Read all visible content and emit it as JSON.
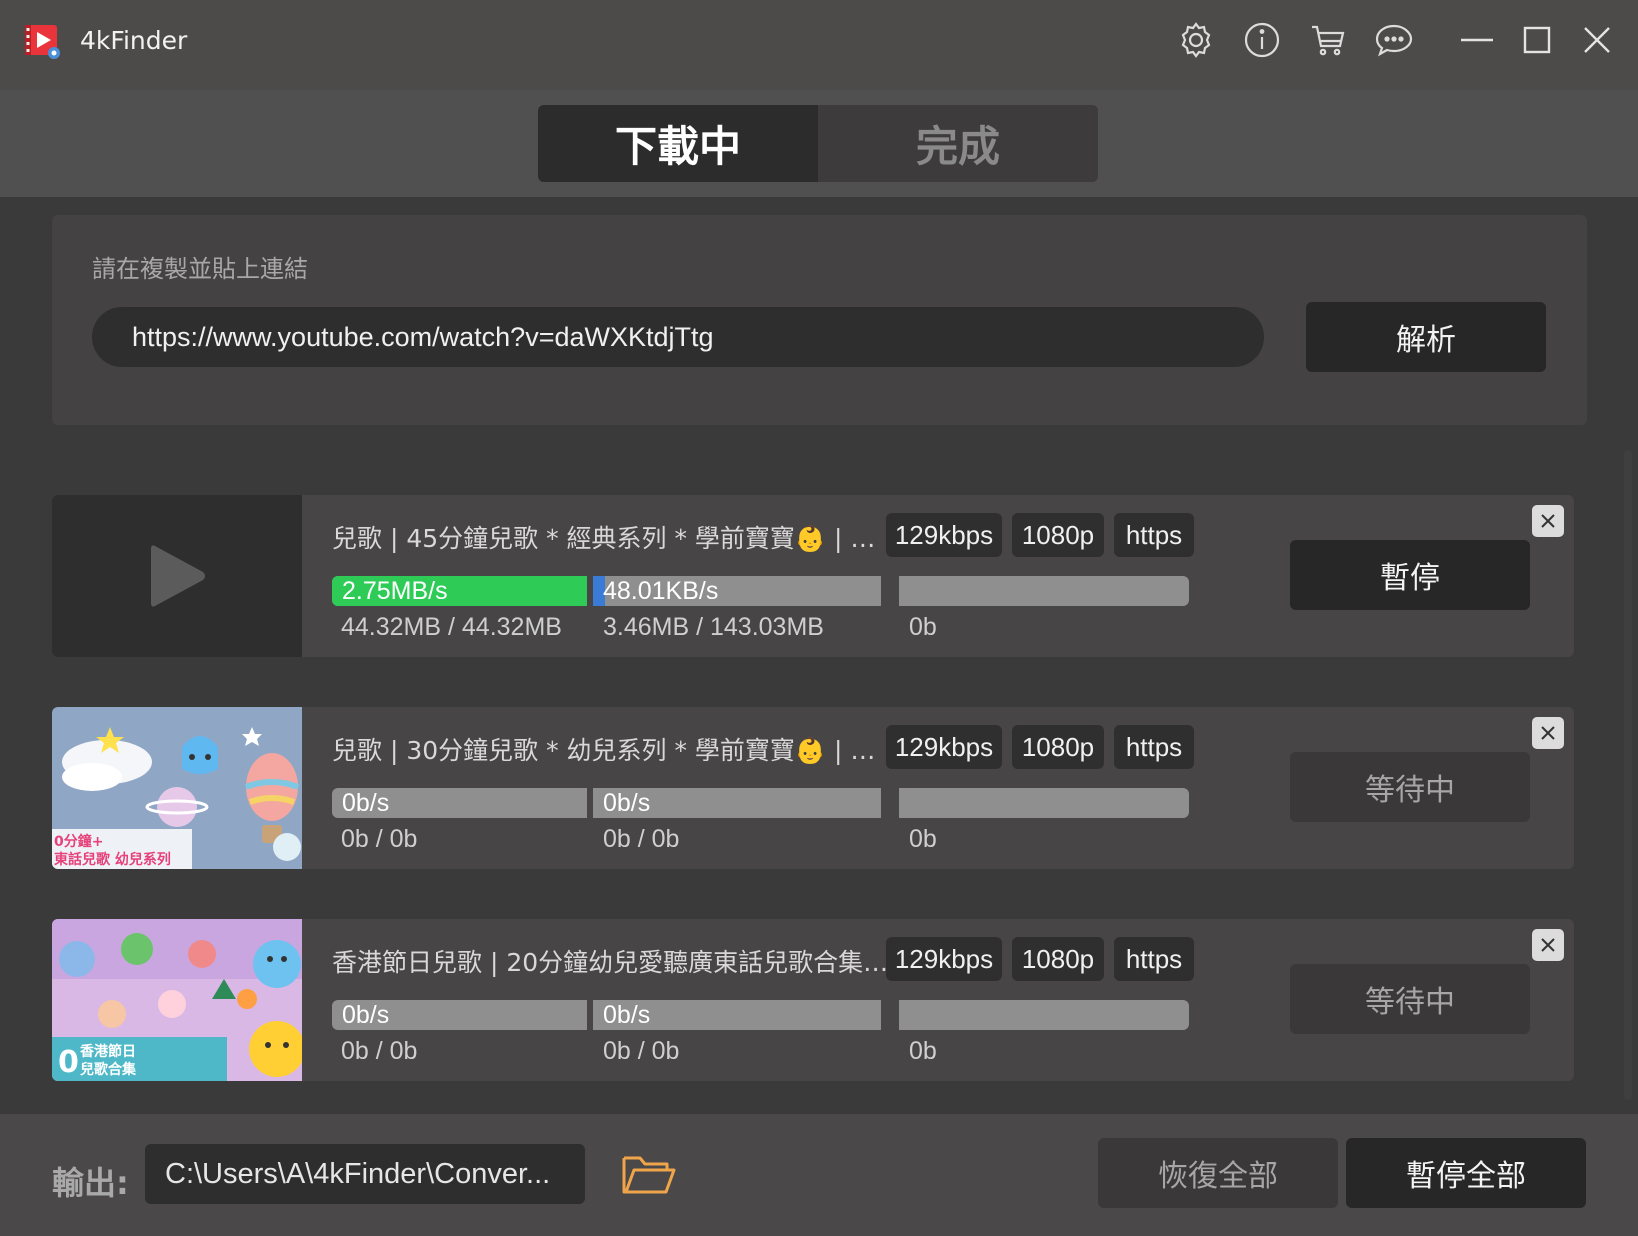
{
  "app": {
    "title": "4kFinder"
  },
  "titlebar_icons": [
    "settings-icon",
    "info-icon",
    "cart-icon",
    "feedback-icon",
    "minimize-icon",
    "maximize-icon",
    "close-icon"
  ],
  "tabs": {
    "downloading": "下載中",
    "completed": "完成",
    "active": "downloading"
  },
  "url_panel": {
    "hint": "請在複製並貼上連結",
    "url_value": "https://www.youtube.com/watch?v=daWXKtdjTtg",
    "parse_label": "解析"
  },
  "items": [
    {
      "title": "兒歌 | 45分鐘兒歌 * 經典系列 * 學前寶寶👶 | 十...",
      "audio_quality": "129kbps",
      "resolution": "1080p",
      "protocol": "https",
      "progress": [
        {
          "speed": "2.75MB/s",
          "size": "44.32MB / 44.32MB",
          "fraction": 1.0,
          "color": "#2ecc57"
        },
        {
          "speed": "48.01KB/s",
          "size": "3.46MB / 143.03MB",
          "fraction": 0.024,
          "color": "#3a7bd5"
        },
        {
          "speed": "",
          "size": "0b",
          "fraction": 0,
          "color": "#3a7bd5"
        }
      ],
      "action": "暫停",
      "thumbnail": "none"
    },
    {
      "title": "兒歌 | 30分鐘兒歌 * 幼兒系列 * 學前寶寶👶 | 顏...",
      "audio_quality": "129kbps",
      "resolution": "1080p",
      "protocol": "https",
      "progress": [
        {
          "speed": "0b/s",
          "size": "0b / 0b",
          "fraction": 0,
          "color": "#3a7bd5"
        },
        {
          "speed": "0b/s",
          "size": "0b / 0b",
          "fraction": 0,
          "color": "#3a7bd5"
        },
        {
          "speed": "",
          "size": "0b",
          "fraction": 0,
          "color": "#3a7bd5"
        }
      ],
      "action": "等待中",
      "thumbnail": {
        "caption_line1": "0分鐘+",
        "caption_line2": "東話兒歌 幼兒系列"
      }
    },
    {
      "title": "香港節日兒歌 | 20分鐘幼兒愛聽廣東話兒歌合集 | ...",
      "audio_quality": "129kbps",
      "resolution": "1080p",
      "protocol": "https",
      "progress": [
        {
          "speed": "0b/s",
          "size": "0b / 0b",
          "fraction": 0,
          "color": "#3a7bd5"
        },
        {
          "speed": "0b/s",
          "size": "0b / 0b",
          "fraction": 0,
          "color": "#3a7bd5"
        },
        {
          "speed": "",
          "size": "0b",
          "fraction": 0,
          "color": "#3a7bd5"
        }
      ],
      "action": "等待中",
      "thumbnail": {
        "caption_line1": "香港節日",
        "caption_line2": "兒歌合集"
      }
    }
  ],
  "footer": {
    "output_label": "輸出:",
    "output_path": "C:\\Users\\A\\4kFinder\\Conver...",
    "resume_all": "恢復全部",
    "pause_all": "暫停全部"
  }
}
